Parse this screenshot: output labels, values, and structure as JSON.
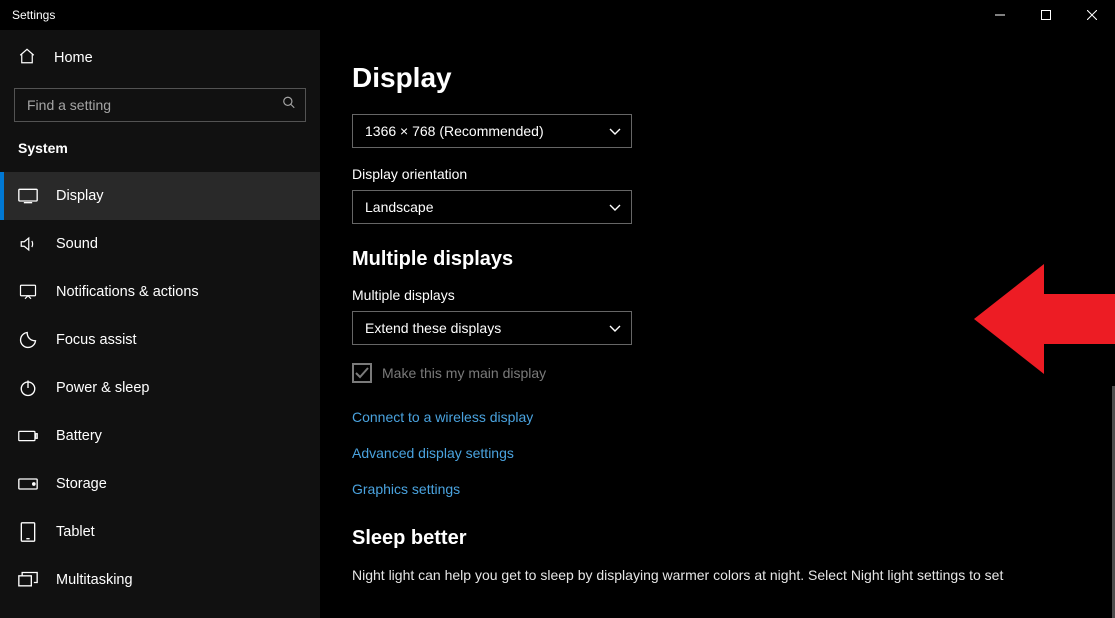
{
  "window": {
    "title": "Settings"
  },
  "sidebar": {
    "home_label": "Home",
    "search_placeholder": "Find a setting",
    "section": "System",
    "items": [
      {
        "label": "Display",
        "active": true
      },
      {
        "label": "Sound"
      },
      {
        "label": "Notifications & actions"
      },
      {
        "label": "Focus assist"
      },
      {
        "label": "Power & sleep"
      },
      {
        "label": "Battery"
      },
      {
        "label": "Storage"
      },
      {
        "label": "Tablet"
      },
      {
        "label": "Multitasking"
      }
    ]
  },
  "main": {
    "page_title": "Display",
    "resolution_value": "1366 × 768 (Recommended)",
    "orientation_label": "Display orientation",
    "orientation_value": "Landscape",
    "multi_heading": "Multiple displays",
    "multi_label": "Multiple displays",
    "multi_value": "Extend these displays",
    "main_display_checkbox": "Make this my main display",
    "links": {
      "wireless": "Connect to a wireless display",
      "advanced": "Advanced display settings",
      "graphics": "Graphics settings"
    },
    "sleep_heading": "Sleep better",
    "sleep_text": "Night light can help you get to sleep by displaying warmer colors at night. Select Night light settings to set"
  }
}
